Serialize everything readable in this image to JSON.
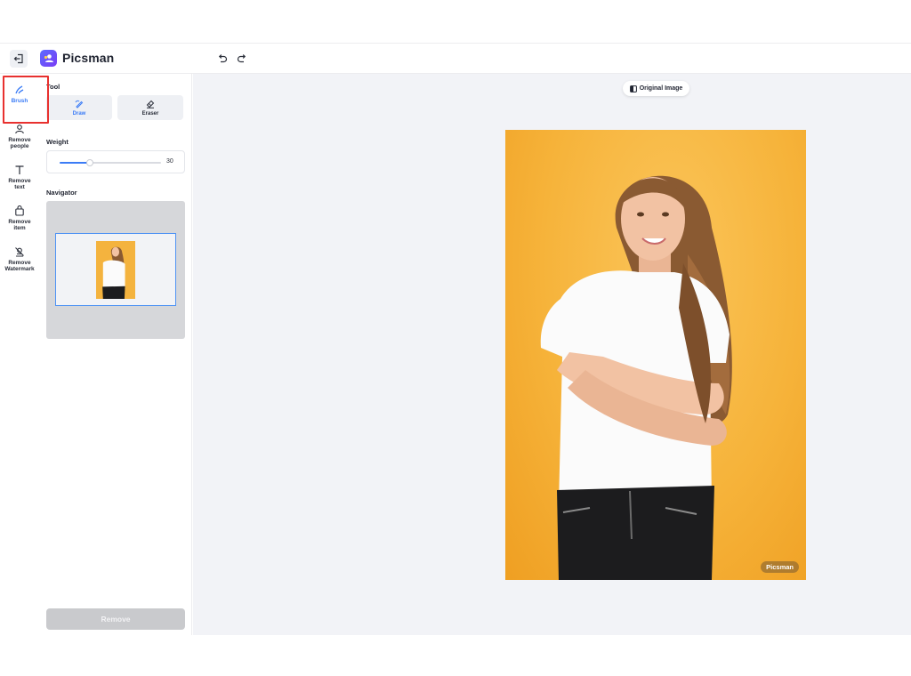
{
  "header": {
    "app_name": "Picsman",
    "icons": {
      "back": "exit-icon",
      "logo": "picsman-logo",
      "undo": "undo-icon",
      "redo": "redo-icon"
    }
  },
  "rail": {
    "items": [
      {
        "label": "Brush",
        "icon": "brush-icon",
        "active": true
      },
      {
        "label": "Remove people",
        "icon": "person-icon",
        "active": false
      },
      {
        "label": "Remove text",
        "icon": "text-icon",
        "active": false
      },
      {
        "label": "Remove item",
        "icon": "bag-icon",
        "active": false
      },
      {
        "label": "Remove Watermark",
        "icon": "watermark-icon",
        "active": false
      }
    ]
  },
  "panel": {
    "tool_label": "Tool",
    "tools": [
      {
        "label": "Draw",
        "icon": "pen-icon",
        "active": true
      },
      {
        "label": "Eraser",
        "icon": "eraser-icon",
        "active": false
      }
    ],
    "weight_label": "Weight",
    "weight_value": "30",
    "weight_fraction": 0.3,
    "navigator_label": "Navigator",
    "remove_label": "Remove"
  },
  "canvas": {
    "original_image_label": "Original Image",
    "watermark_text": "Picsman"
  },
  "colors": {
    "accent": "#3b7cf6",
    "highlight": "#e8312f",
    "background_photo": "#f6b33a",
    "canvas_bg": "#f2f3f7"
  }
}
